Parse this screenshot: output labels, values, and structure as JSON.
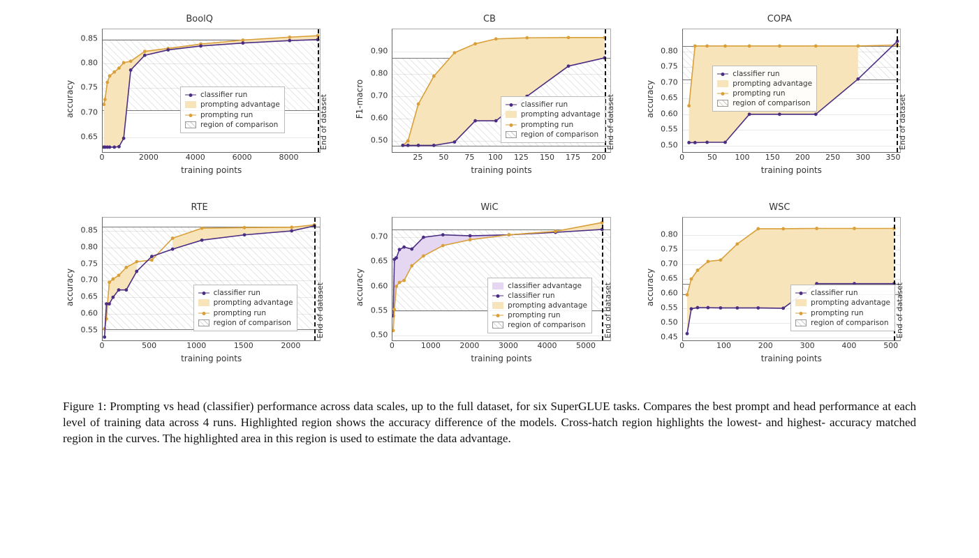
{
  "figure_label": "Figure 1:",
  "caption_text": "Prompting vs head (classifier) performance across data scales, up to the full dataset, for six SuperGLUE tasks. Compares the best prompt and head performance at each level of training data across 4 runs. Highlighted region shows the accuracy difference of the models. Cross-hatch region highlights the lowest- and highest- accuracy matched region in the curves. The highlighted area in this region is used to estimate the data advantage.",
  "common": {
    "xlabel": "training points",
    "end_label": "End of dataset",
    "colors": {
      "classifier": "#4b2e83",
      "prompting": "#d9a03a",
      "prompting_fill": "#f8e4bb",
      "classifier_fill": "#e5d6f2"
    }
  },
  "legend": {
    "classifier_run": "classifier run",
    "prompting_advantage": "prompting advantage",
    "prompting_run": "prompting run",
    "region_of_comparison": "region of comparison",
    "classifier_advantage": "classifier advantage"
  },
  "chart_data": [
    {
      "id": "boolq",
      "title": "BoolQ",
      "ylabel": "accuracy",
      "xlim": [
        0,
        9300
      ],
      "ylim": [
        0.62,
        0.87
      ],
      "xticks": [
        0,
        2000,
        4000,
        6000,
        8000
      ],
      "yticks": [
        0.65,
        0.7,
        0.75,
        0.8,
        0.85
      ],
      "hatch_band": [
        0.706,
        0.848
      ],
      "end_x": 9200,
      "legend_pos": {
        "left_pct": 36,
        "bottom_pct": 16
      },
      "legend_keys": [
        "classifier_run",
        "prompting_advantage",
        "prompting_run",
        "region_of_comparison"
      ],
      "series": [
        {
          "name": "prompting run",
          "color_key": "prompting",
          "x": [
            50,
            100,
            200,
            300,
            500,
            700,
            900,
            1200,
            1800,
            2800,
            4200,
            6000,
            8000,
            9200
          ],
          "y": [
            0.717,
            0.727,
            0.762,
            0.775,
            0.783,
            0.791,
            0.802,
            0.805,
            0.825,
            0.831,
            0.84,
            0.848,
            0.854,
            0.857
          ]
        },
        {
          "name": "classifier run",
          "color_key": "classifier",
          "x": [
            50,
            100,
            200,
            300,
            500,
            700,
            900,
            1200,
            1800,
            2800,
            4200,
            6000,
            8000,
            9200
          ],
          "y": [
            0.63,
            0.63,
            0.63,
            0.63,
            0.63,
            0.631,
            0.648,
            0.787,
            0.817,
            0.828,
            0.836,
            0.842,
            0.847,
            0.849
          ]
        }
      ],
      "fill_between": {
        "upper": "prompting run",
        "lower": "classifier run",
        "where": "upper_gt_lower",
        "color_key": "prompting_fill"
      }
    },
    {
      "id": "cb",
      "title": "CB",
      "ylabel": "F1-macro",
      "xlim": [
        0,
        210
      ],
      "ylim": [
        0.45,
        1.0
      ],
      "xticks": [
        25,
        50,
        75,
        100,
        125,
        150,
        175,
        200
      ],
      "yticks": [
        0.5,
        0.6,
        0.7,
        0.8,
        0.9
      ],
      "hatch_band": [
        0.48,
        0.872
      ],
      "end_x": 205,
      "legend_pos": {
        "left_pct": 50,
        "bottom_pct": 8
      },
      "legend_keys": [
        "classifier_run",
        "prompting_advantage",
        "prompting_run",
        "region_of_comparison"
      ],
      "series": [
        {
          "name": "prompting run",
          "color_key": "prompting",
          "x": [
            10,
            15,
            25,
            40,
            60,
            80,
            100,
            130,
            170,
            205
          ],
          "y": [
            0.48,
            0.5,
            0.665,
            0.79,
            0.895,
            0.935,
            0.957,
            0.962,
            0.963,
            0.963
          ]
        },
        {
          "name": "classifier run",
          "color_key": "classifier",
          "x": [
            10,
            15,
            25,
            40,
            60,
            80,
            100,
            130,
            170,
            205
          ],
          "y": [
            0.48,
            0.48,
            0.48,
            0.48,
            0.495,
            0.59,
            0.59,
            0.7,
            0.835,
            0.872
          ]
        }
      ],
      "fill_between": {
        "upper": "prompting run",
        "lower": "classifier run",
        "where": "upper_gt_lower",
        "color_key": "prompting_fill"
      }
    },
    {
      "id": "copa",
      "title": "COPA",
      "ylabel": "accuracy",
      "xlim": [
        0,
        360
      ],
      "ylim": [
        0.48,
        0.87
      ],
      "xticks": [
        0,
        50,
        100,
        150,
        200,
        250,
        300,
        350
      ],
      "yticks": [
        0.5,
        0.55,
        0.6,
        0.65,
        0.7,
        0.75,
        0.8
      ],
      "hatch_band": [
        0.712,
        0.817
      ],
      "end_x": 355,
      "legend_pos": {
        "left_pct": 14,
        "top_pct": 30
      },
      "legend_keys": [
        "classifier_run",
        "prompting_advantage",
        "prompting_run",
        "region_of_comparison"
      ],
      "series": [
        {
          "name": "prompting run",
          "color_key": "prompting",
          "x": [
            10,
            20,
            40,
            70,
            110,
            160,
            220,
            290,
            355
          ],
          "y": [
            0.627,
            0.817,
            0.817,
            0.817,
            0.817,
            0.817,
            0.817,
            0.817,
            0.82
          ]
        },
        {
          "name": "classifier run",
          "color_key": "classifier",
          "x": [
            10,
            20,
            40,
            70,
            110,
            160,
            220,
            290,
            355
          ],
          "y": [
            0.51,
            0.51,
            0.511,
            0.511,
            0.6,
            0.6,
            0.6,
            0.712,
            0.832
          ]
        }
      ],
      "fill_between": {
        "upper": "prompting run",
        "lower": "classifier run",
        "where": "upper_gt_lower",
        "color_key": "prompting_fill"
      }
    },
    {
      "id": "rte",
      "title": "RTE",
      "ylabel": "accuracy",
      "xlim": [
        0,
        2300
      ],
      "ylim": [
        0.52,
        0.89
      ],
      "xticks": [
        0,
        500,
        1000,
        1500,
        2000
      ],
      "yticks": [
        0.55,
        0.6,
        0.65,
        0.7,
        0.75,
        0.8,
        0.85
      ],
      "hatch_band": [
        0.555,
        0.863
      ],
      "end_x": 2240,
      "legend_pos": {
        "left_pct": 42,
        "bottom_pct": 8
      },
      "legend_keys": [
        "classifier_run",
        "prompting_advantage",
        "prompting_run",
        "region_of_comparison"
      ],
      "series": [
        {
          "name": "prompting run",
          "color_key": "prompting",
          "x": [
            20,
            40,
            70,
            110,
            170,
            250,
            360,
            520,
            740,
            1050,
            1500,
            2000,
            2240
          ],
          "y": [
            0.555,
            0.585,
            0.695,
            0.705,
            0.716,
            0.74,
            0.757,
            0.762,
            0.828,
            0.858,
            0.86,
            0.861,
            0.868
          ]
        },
        {
          "name": "classifier run",
          "color_key": "classifier",
          "x": [
            20,
            40,
            70,
            110,
            170,
            250,
            360,
            520,
            740,
            1050,
            1500,
            2000,
            2240
          ],
          "y": [
            0.53,
            0.63,
            0.63,
            0.65,
            0.672,
            0.672,
            0.728,
            0.773,
            0.795,
            0.822,
            0.838,
            0.85,
            0.865
          ]
        }
      ],
      "fill_between": {
        "upper": "prompting run",
        "lower": "classifier run",
        "where": "upper_gt_lower",
        "color_key": "prompting_fill"
      }
    },
    {
      "id": "wic",
      "title": "WiC",
      "ylabel": "accuracy",
      "xlim": [
        0,
        5600
      ],
      "ylim": [
        0.49,
        0.74
      ],
      "xticks": [
        0,
        1000,
        2000,
        3000,
        4000,
        5000
      ],
      "yticks": [
        0.5,
        0.55,
        0.6,
        0.65,
        0.7
      ],
      "hatch_band": [
        0.553,
        0.716
      ],
      "end_x": 5400,
      "legend_pos": {
        "left_pct": 44,
        "bottom_pct": 6
      },
      "legend_keys": [
        "classifier_advantage",
        "classifier_run",
        "prompting_advantage",
        "prompting_run",
        "region_of_comparison"
      ],
      "series": [
        {
          "name": "classifier run",
          "color_key": "classifier",
          "x": [
            20,
            50,
            100,
            180,
            300,
            500,
            800,
            1300,
            2000,
            3000,
            4200,
            5400
          ],
          "y": [
            0.54,
            0.655,
            0.658,
            0.675,
            0.68,
            0.676,
            0.7,
            0.705,
            0.703,
            0.705,
            0.71,
            0.716
          ]
        },
        {
          "name": "prompting run",
          "color_key": "prompting",
          "x": [
            20,
            50,
            100,
            180,
            300,
            500,
            800,
            1300,
            2000,
            3000,
            4200,
            5400
          ],
          "y": [
            0.51,
            0.553,
            0.6,
            0.608,
            0.612,
            0.642,
            0.662,
            0.683,
            0.695,
            0.705,
            0.712,
            0.73
          ]
        }
      ],
      "fills": [
        {
          "upper": "classifier run",
          "lower": "prompting run",
          "where": "upper_gt_lower",
          "color_key": "classifier_fill"
        },
        {
          "upper": "prompting run",
          "lower": "classifier run",
          "where": "upper_gt_lower",
          "color_key": "prompting_fill"
        }
      ]
    },
    {
      "id": "wsc",
      "title": "WSC",
      "ylabel": "accuracy",
      "xlim": [
        0,
        520
      ],
      "ylim": [
        0.44,
        0.86
      ],
      "xticks": [
        0,
        100,
        200,
        300,
        400,
        500
      ],
      "yticks": [
        0.45,
        0.5,
        0.55,
        0.6,
        0.65,
        0.7,
        0.75,
        0.8
      ],
      "hatch_band": [
        0.6,
        0.634
      ],
      "end_x": 505,
      "legend_pos": {
        "left_pct": 50,
        "bottom_pct": 8
      },
      "legend_keys": [
        "classifier_run",
        "prompting_advantage",
        "prompting_run",
        "region_of_comparison"
      ],
      "series": [
        {
          "name": "prompting run",
          "color_key": "prompting",
          "x": [
            10,
            20,
            35,
            60,
            90,
            130,
            180,
            240,
            320,
            410,
            505
          ],
          "y": [
            0.596,
            0.65,
            0.68,
            0.71,
            0.715,
            0.77,
            0.822,
            0.822,
            0.823,
            0.823,
            0.823
          ]
        },
        {
          "name": "classifier run",
          "color_key": "classifier",
          "x": [
            10,
            20,
            35,
            60,
            90,
            130,
            180,
            240,
            320,
            410,
            505
          ],
          "y": [
            0.463,
            0.548,
            0.552,
            0.552,
            0.551,
            0.551,
            0.551,
            0.55,
            0.634,
            0.634,
            0.634
          ]
        }
      ],
      "fill_between": {
        "upper": "prompting run",
        "lower": "classifier run",
        "where": "upper_gt_lower",
        "color_key": "prompting_fill"
      }
    }
  ]
}
